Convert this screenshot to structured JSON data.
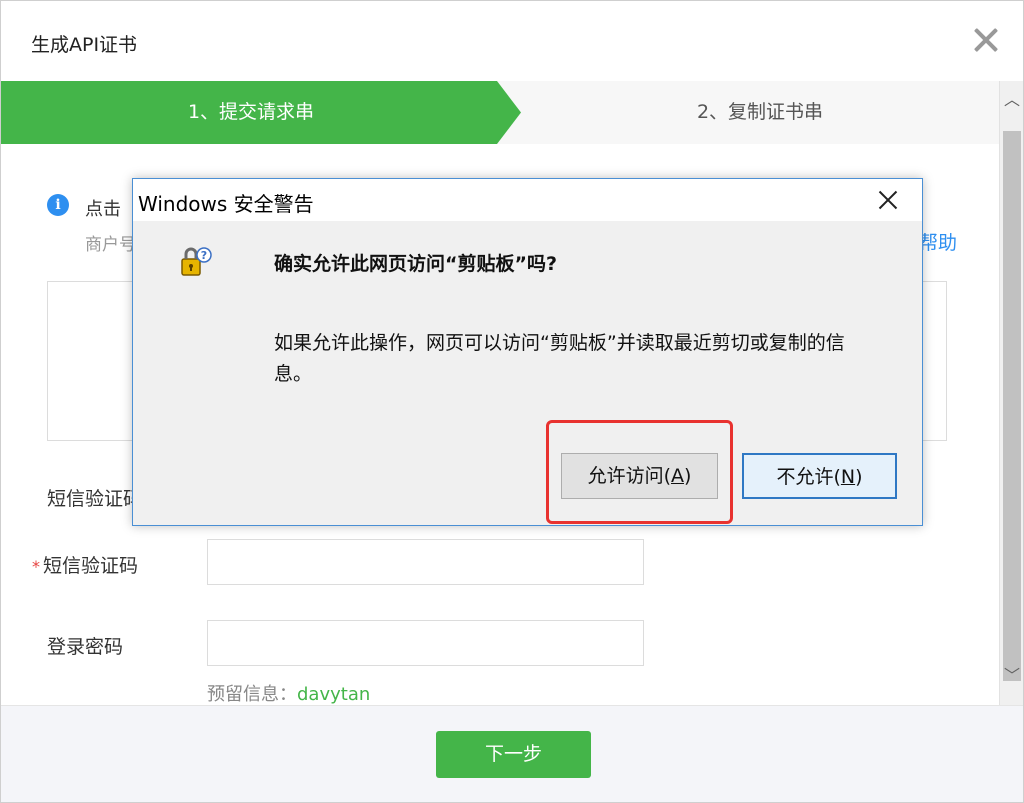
{
  "outer_dialog": {
    "title": "生成API证书",
    "close_icon": "close-icon"
  },
  "steps": [
    {
      "label": "1、提交请求串",
      "active": true
    },
    {
      "label": "2、复制证书串",
      "active": false
    }
  ],
  "content": {
    "info_text": "点击",
    "info_sub": "商户号",
    "help_link": "帮助",
    "sms_label_partial": "短信验证码",
    "required_marker": "*",
    "sms_label": "短信验证码",
    "sms_value": "",
    "password_label": "登录密码",
    "password_value": "",
    "reserved_label": "预留信息：",
    "reserved_value": "davytan"
  },
  "footer": {
    "next_label": "下一步"
  },
  "security_dialog": {
    "title": "Windows 安全警告",
    "question": "确实允许此网页访问“剪贴板”吗?",
    "description": "如果允许此操作，网页可以访问“剪贴板”并读取最近剪切或复制的信息。",
    "allow_text": "允许访问(",
    "allow_key": "A",
    "allow_end": ")",
    "deny_text": "不允许(",
    "deny_key": "N",
    "deny_end": ")"
  },
  "colors": {
    "brand_green": "#44b549",
    "link_blue": "#2e8ff0",
    "highlight_red": "#e8322f",
    "required_red": "#e64340"
  }
}
